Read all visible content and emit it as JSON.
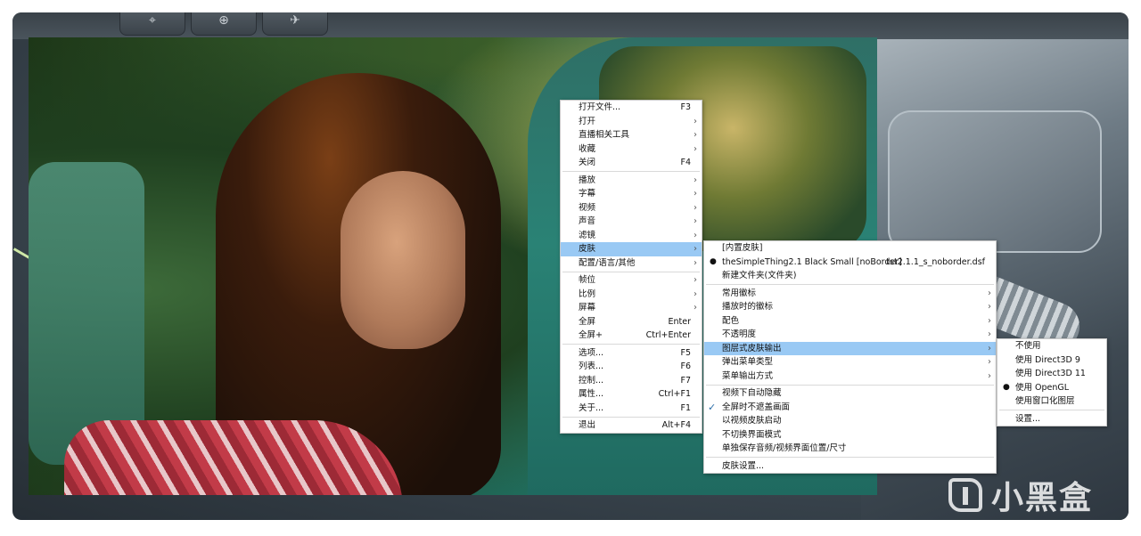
{
  "main_menu": {
    "groups": [
      [
        {
          "label": "打开文件...",
          "shortcut": "F3"
        },
        {
          "label": "打开",
          "arrow": true
        },
        {
          "label": "直播相关工具",
          "arrow": true
        },
        {
          "label": "收藏",
          "arrow": true
        },
        {
          "label": "关闭",
          "shortcut": "F4"
        }
      ],
      [
        {
          "label": "播放",
          "arrow": true
        },
        {
          "label": "字幕",
          "arrow": true
        },
        {
          "label": "视频",
          "arrow": true
        },
        {
          "label": "声音",
          "arrow": true
        },
        {
          "label": "滤镜",
          "arrow": true
        },
        {
          "label": "皮肤",
          "arrow": true,
          "highlighted": true
        },
        {
          "label": "配置/语言/其他",
          "arrow": true
        }
      ],
      [
        {
          "label": "帧位",
          "arrow": true
        },
        {
          "label": "比例",
          "arrow": true
        },
        {
          "label": "屏幕",
          "arrow": true
        },
        {
          "label": "全屏",
          "shortcut": "Enter"
        },
        {
          "label": "全屏+",
          "shortcut": "Ctrl+Enter"
        }
      ],
      [
        {
          "label": "选项...",
          "shortcut": "F5"
        },
        {
          "label": "列表...",
          "shortcut": "F6"
        },
        {
          "label": "控制...",
          "shortcut": "F7"
        },
        {
          "label": "属性...",
          "shortcut": "Ctrl+F1"
        },
        {
          "label": "关于...",
          "shortcut": "F1"
        }
      ],
      [
        {
          "label": "退出",
          "shortcut": "Alt+F4"
        }
      ]
    ]
  },
  "skin_menu": {
    "groups": [
      [
        {
          "label": "[内置皮肤]"
        },
        {
          "label": "theSimpleThing2.1 Black Small [noBorder]",
          "extra": "tst2.1.1_s_noborder.dsf",
          "bullet": true
        },
        {
          "label": "新建文件夹(文件夹)"
        }
      ],
      [
        {
          "label": "常用徽标",
          "arrow": true
        },
        {
          "label": "播放时的徽标",
          "arrow": true
        },
        {
          "label": "配色",
          "arrow": true
        },
        {
          "label": "不透明度",
          "arrow": true
        },
        {
          "label": "图层式皮肤输出",
          "arrow": true,
          "highlighted": true
        },
        {
          "label": "弹出菜单类型",
          "arrow": true
        },
        {
          "label": "菜单输出方式",
          "arrow": true
        }
      ],
      [
        {
          "label": "视频下自动隐藏"
        },
        {
          "label": "全屏时不遮盖画面",
          "checked": true
        },
        {
          "label": "以视频皮肤启动"
        },
        {
          "label": "不切换界面模式"
        },
        {
          "label": "单独保存音频/视频界面位置/尺寸"
        }
      ],
      [
        {
          "label": "皮肤设置..."
        }
      ]
    ]
  },
  "layer_menu": {
    "groups": [
      [
        {
          "label": "不使用"
        },
        {
          "label": "使用 Direct3D 9"
        },
        {
          "label": "使用 Direct3D 11"
        },
        {
          "label": "使用 OpenGL",
          "bullet": true
        },
        {
          "label": "使用窗口化图层"
        }
      ],
      [
        {
          "label": "设置..."
        }
      ]
    ]
  },
  "glyphs": {
    "arrow": "›",
    "bullet": "●",
    "check": "✓"
  },
  "background_keys": [
    "⌖",
    "⊕",
    "✈"
  ],
  "watermark": {
    "text": "小黑盒"
  },
  "colors": {
    "highlight": "#99c9f4",
    "menu_bg": "#ffffff",
    "separator": "#d9d9d9"
  }
}
